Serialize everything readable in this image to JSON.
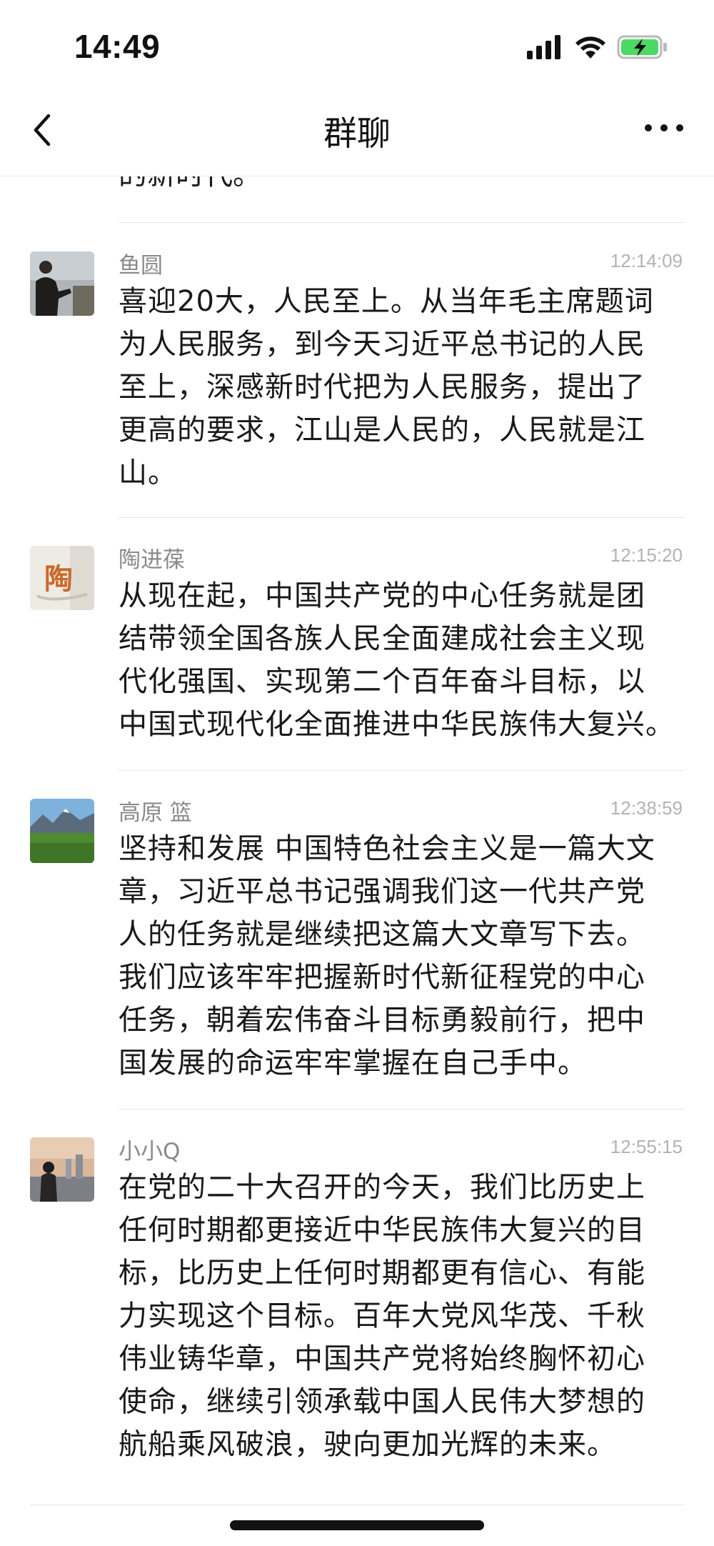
{
  "status_bar": {
    "time": "14:49"
  },
  "nav": {
    "title": "群聊",
    "back_icon": "chevron-left-icon",
    "more_icon": "more-horizontal-icon"
  },
  "chat": {
    "previous_tail": "的新时代。",
    "messages": [
      {
        "sender": "鱼圆",
        "time": "12:14:09",
        "text": "喜迎20大，人民至上。从当年毛主席题词\n为人民服务，到今天习近平总书记的人民\n至上，深感新时代把为人民服务，提出了\n更高的要求，江山是人民的，人民就是江\n山。"
      },
      {
        "sender": "陶进葆",
        "time": "12:15:20",
        "avatar_char": "陶",
        "text": "从现在起，中国共产党的中心任务就是团\n结带领全国各族人民全面建成社会主义现\n代化强国、实现第二个百年奋斗目标，以\n中国式现代化全面推进中华民族伟大复兴。"
      },
      {
        "sender": "高原  篮",
        "time": "12:38:59",
        "text": "坚持和发展 中国特色社会主义是一篇大文\n章，习近平总书记强调我们这一代共产党\n人的任务就是继续把这篇大文章写下去。\n我们应该牢牢把握新时代新征程党的中心\n任务，朝着宏伟奋斗目标勇毅前行，把中\n国发展的命运牢牢掌握在自己手中。"
      },
      {
        "sender": "小小Q",
        "time": "12:55:15",
        "text": "在党的二十大召开的今天，我们比历史上\n任何时期都更接近中华民族伟大复兴的目\n标，比历史上任何时期都更有信心、有能\n力实现这个目标。百年大党风华茂、千秋\n伟业铸华章，中国共产党将始终胸怀初心\n使命，继续引领承载中国人民伟大梦想的\n航船乘风破浪，驶向更加光辉的未来。"
      }
    ]
  },
  "colors": {
    "battery_fill": "#4cd964",
    "sender_gray": "#8a8a8a",
    "time_gray": "#b3b3b3",
    "text": "#191919"
  }
}
